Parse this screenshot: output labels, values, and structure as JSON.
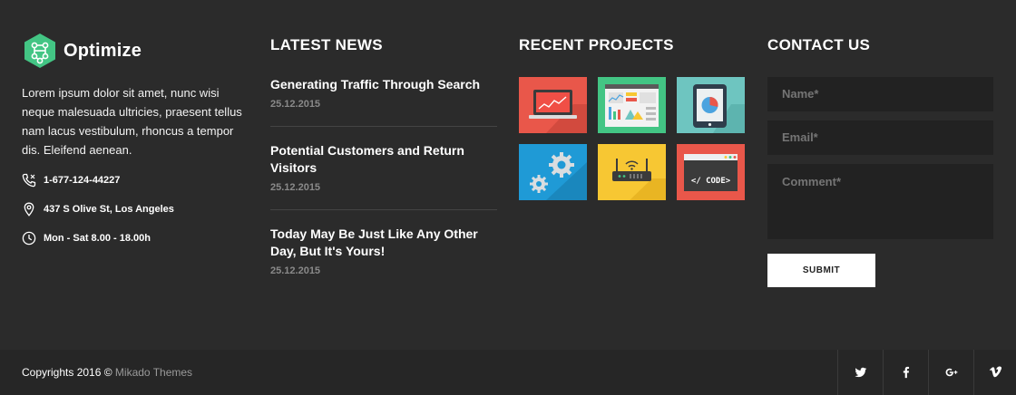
{
  "about": {
    "logo_text": "Optimize",
    "logo_icon": "hexagon-network-icon",
    "description": "Lorem ipsum dolor sit amet, nunc wisi neque malesuada ultricies, praesent tellus nam lacus vestibulum, rhoncus a tempor dis. Eleifend aenean.",
    "phone": "1-677-124-44227",
    "address": "437 S Olive St, Los Angeles",
    "hours": "Mon - Sat 8.00 - 18.00h"
  },
  "news": {
    "title": "LATEST NEWS",
    "items": [
      {
        "title": "Generating Traffic Through Search",
        "date": "25.12.2015"
      },
      {
        "title": "Potential Customers and Return Visitors",
        "date": "25.12.2015"
      },
      {
        "title": "Today May Be Just Like Any Other Day, But It's Yours!",
        "date": "25.12.2015"
      }
    ]
  },
  "projects": {
    "title": "RECENT PROJECTS",
    "items": [
      {
        "name": "laptop-chart-icon",
        "bg": "#e9574a"
      },
      {
        "name": "dashboard-icon",
        "bg": "#43c584"
      },
      {
        "name": "tablet-pie-icon",
        "bg": "#6ec5c0"
      },
      {
        "name": "gears-icon",
        "bg": "#1f9ad6"
      },
      {
        "name": "router-icon",
        "bg": "#f7c733"
      },
      {
        "name": "code-window-icon",
        "bg": "#e9574a",
        "label": "</ CODE>"
      }
    ]
  },
  "contact": {
    "title": "CONTACT US",
    "name_placeholder": "Name*",
    "email_placeholder": "Email*",
    "comment_placeholder": "Comment*",
    "submit_label": "SUBMIT"
  },
  "bottom": {
    "copyright_prefix": "Copyrights 2016 ©",
    "copyright_brand": "Mikado Themes",
    "social": [
      "twitter-icon",
      "facebook-icon",
      "google-plus-icon",
      "vimeo-icon"
    ]
  },
  "colors": {
    "accent": "#43c584",
    "background": "#2b2b2b",
    "bottom_bar": "#262626"
  }
}
